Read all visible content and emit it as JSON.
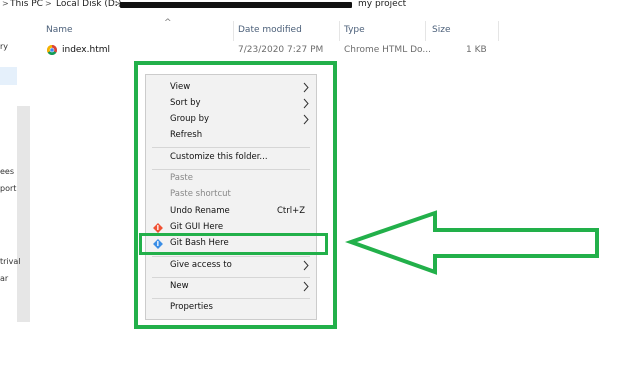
{
  "window": {
    "breadcrumb": {
      "this_pc": "This PC",
      "drive": "Local Disk (D:)",
      "folder": "my project",
      "separator": ">"
    }
  },
  "navpane": {
    "fragments": [
      "ry",
      "ees",
      "port",
      "trival",
      "ar"
    ]
  },
  "columns": {
    "name": "Name",
    "date_modified": "Date modified",
    "type": "Type",
    "size": "Size"
  },
  "files": [
    {
      "name": "index.html",
      "date_modified": "7/23/2020 7:27 PM",
      "type": "Chrome HTML Do...",
      "size": "1 KB",
      "icon": "chrome-icon"
    }
  ],
  "context_menu": {
    "view": "View",
    "sort_by": "Sort by",
    "group_by": "Group by",
    "refresh": "Refresh",
    "customize": "Customize this folder...",
    "paste": "Paste",
    "paste_shortcut": "Paste shortcut",
    "undo_rename": "Undo Rename",
    "undo_shortcut": "Ctrl+Z",
    "git_gui": "Git GUI Here",
    "git_bash": "Git Bash Here",
    "give_access": "Give access to",
    "new": "New",
    "properties": "Properties"
  },
  "colors": {
    "annotation_green": "#22b04a",
    "menu_bg": "#f2f2f2",
    "git_orange": "#f05133"
  }
}
